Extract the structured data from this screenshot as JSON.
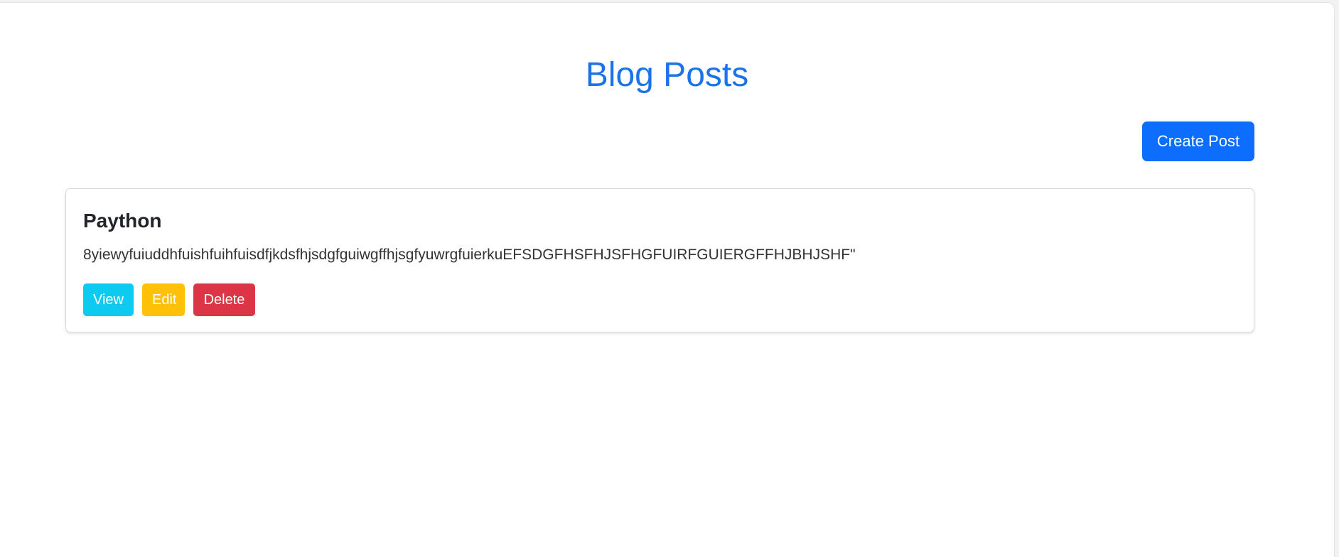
{
  "header": {
    "title": "Blog Posts",
    "create_label": "Create Post"
  },
  "posts": [
    {
      "title": "Paython",
      "body": "8yiewyfuiuddhfuishfuihfuisdfjkdsfhjsdgfguiwgffhjsgfyuwrgfuierkuEFSDGFHSFHJSFHGFUIRFGUIERGFFHJBHJSHF\"",
      "view_label": "View",
      "edit_label": "Edit",
      "delete_label": "Delete"
    }
  ],
  "colors": {
    "title": "#1a73e8",
    "primary": "#0d6efd",
    "info": "#0dcaf0",
    "warning": "#ffc107",
    "danger": "#dc3545"
  }
}
